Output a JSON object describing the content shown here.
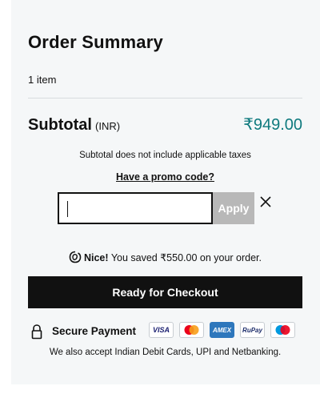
{
  "summary": {
    "title": "Order Summary",
    "items_count": "1 item",
    "subtotal_label": "Subtotal",
    "subtotal_currency": "(INR)",
    "subtotal_amount": "₹949.00",
    "tax_note": "Subtotal does not include applicable taxes",
    "promo_link": "Have a promo code?",
    "promo_input_value": "",
    "apply_label": "Apply",
    "saved_prefix": "Nice!",
    "saved_text": "You saved ₹550.00 on your order.",
    "checkout_label": "Ready for Checkout",
    "secure_label": "Secure Payment",
    "also_accept": "We also accept Indian Debit Cards, UPI and Netbanking.",
    "amount_color": "#0f7a7e"
  },
  "cards": [
    {
      "name": "visa",
      "label": "VISA"
    },
    {
      "name": "mastercard",
      "label": ""
    },
    {
      "name": "amex",
      "label": "AMEX"
    },
    {
      "name": "rupay",
      "label": "RuPay"
    },
    {
      "name": "maestro",
      "label": ""
    }
  ]
}
